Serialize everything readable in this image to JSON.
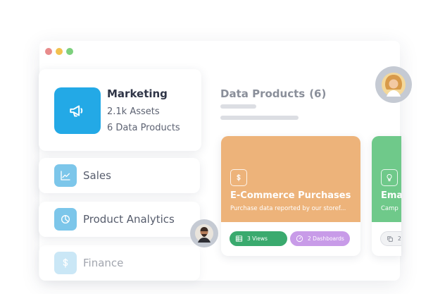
{
  "window": {
    "dots": [
      "#e88b8b",
      "#f2c14e",
      "#7dd07d"
    ]
  },
  "marketing": {
    "name": "Marketing",
    "assets": "2.1k Assets",
    "products": "6 Data Products",
    "icon": "megaphone-icon",
    "color": "#23a9e6"
  },
  "domains": [
    {
      "label": "Sales",
      "icon": "line-chart-icon",
      "color": "#7cc6ea"
    },
    {
      "label": "Product Analytics",
      "icon": "pie-chart-icon",
      "color": "#7cc6ea"
    },
    {
      "label": "Finance",
      "icon": "dollar-icon",
      "color": "#bfe3f5"
    }
  ],
  "data_products": {
    "title": "Data Products",
    "count": "(6)"
  },
  "products": [
    {
      "title": "E-Commerce Purchases",
      "description": "Purchase data reported by our storef...",
      "color": "#edb37a",
      "icon": "dollar-icon",
      "views": "3 Views",
      "dashboards": "2 Dashboards"
    },
    {
      "title": "Ema",
      "description": "Camp",
      "color": "#6fc98a",
      "icon": "lightbulb-icon",
      "count_label": "2"
    }
  ],
  "colors": {
    "views_pill": "#3aaa6e",
    "dashboards_pill": "#c89be8"
  }
}
